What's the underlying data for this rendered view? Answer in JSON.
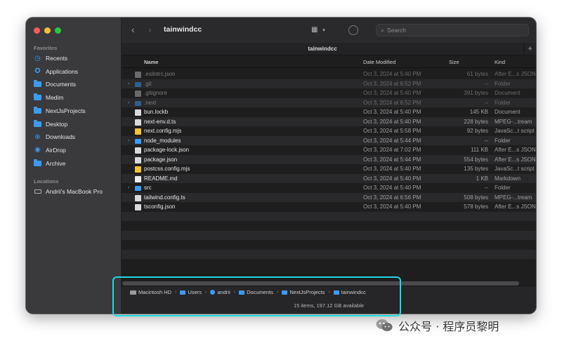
{
  "window": {
    "title": "tainwindcc",
    "tab_title": "tainwindcc",
    "search_placeholder": "Search",
    "view_icon": "grid-view-icon"
  },
  "sidebar": {
    "favorites_label": "Favorites",
    "favorites": [
      {
        "label": "Recents",
        "icon": "clock-icon"
      },
      {
        "label": "Applications",
        "icon": "applications-icon"
      },
      {
        "label": "Documents",
        "icon": "folder-icon"
      },
      {
        "label": "Medim",
        "icon": "folder-icon"
      },
      {
        "label": "NextJsProjects",
        "icon": "folder-icon"
      },
      {
        "label": "Desktop",
        "icon": "folder-icon"
      },
      {
        "label": "Downloads",
        "icon": "download-icon"
      },
      {
        "label": "AirDrop",
        "icon": "airdrop-icon"
      },
      {
        "label": "Archive",
        "icon": "folder-icon"
      }
    ],
    "locations_label": "Locations",
    "locations": [
      {
        "label": "Andrii's MacBook Pro",
        "icon": "laptop-icon"
      }
    ]
  },
  "columns": {
    "name": "Name",
    "date": "Date Modified",
    "size": "Size",
    "kind": "Kind"
  },
  "files": [
    {
      "name": ".eslintrc.json",
      "date": "Oct 3, 2024 at 5:40 PM",
      "size": "61 bytes",
      "kind": "After E...s JSON",
      "type": "doc",
      "hidden": true,
      "folder": false
    },
    {
      "name": ".git",
      "date": "Oct 3, 2024 at 6:52 PM",
      "size": "--",
      "kind": "Folder",
      "type": "folder",
      "hidden": true,
      "folder": true
    },
    {
      "name": ".gitignore",
      "date": "Oct 3, 2024 at 5:40 PM",
      "size": "391 bytes",
      "kind": "Document",
      "type": "doc",
      "hidden": true,
      "folder": false
    },
    {
      "name": ".next",
      "date": "Oct 3, 2024 at 6:52 PM",
      "size": "--",
      "kind": "Folder",
      "type": "folder",
      "hidden": true,
      "folder": true
    },
    {
      "name": "bun.lockb",
      "date": "Oct 3, 2024 at 5:40 PM",
      "size": "145 KB",
      "kind": "Document",
      "type": "doc",
      "hidden": false,
      "folder": false
    },
    {
      "name": "next-env.d.ts",
      "date": "Oct 3, 2024 at 5:40 PM",
      "size": "228 bytes",
      "kind": "MPEG-...tream",
      "type": "doc",
      "hidden": false,
      "folder": false
    },
    {
      "name": "next.config.mjs",
      "date": "Oct 3, 2024 at 5:58 PM",
      "size": "92 bytes",
      "kind": "JavaSc...t script",
      "type": "js",
      "hidden": false,
      "folder": false
    },
    {
      "name": "node_modules",
      "date": "Oct 3, 2024 at 5:44 PM",
      "size": "--",
      "kind": "Folder",
      "type": "folder",
      "hidden": false,
      "folder": true
    },
    {
      "name": "package-lock.json",
      "date": "Oct 3, 2024 at 7:02 PM",
      "size": "111 KB",
      "kind": "After E...s JSON",
      "type": "doc",
      "hidden": false,
      "folder": false
    },
    {
      "name": "package.json",
      "date": "Oct 3, 2024 at 5:44 PM",
      "size": "554 bytes",
      "kind": "After E...s JSON",
      "type": "doc",
      "hidden": false,
      "folder": false
    },
    {
      "name": "postcss.config.mjs",
      "date": "Oct 3, 2024 at 5:40 PM",
      "size": "135 bytes",
      "kind": "JavaSc...t script",
      "type": "js",
      "hidden": false,
      "folder": false
    },
    {
      "name": "README.md",
      "date": "Oct 3, 2024 at 5:40 PM",
      "size": "1 KB",
      "kind": "Markdown",
      "type": "md",
      "hidden": false,
      "folder": false
    },
    {
      "name": "src",
      "date": "Oct 3, 2024 at 5:40 PM",
      "size": "--",
      "kind": "Folder",
      "type": "folder",
      "hidden": false,
      "folder": true
    },
    {
      "name": "tailwind.config.ts",
      "date": "Oct 3, 2024 at 6:56 PM",
      "size": "508 bytes",
      "kind": "MPEG-...tream",
      "type": "doc",
      "hidden": false,
      "folder": false
    },
    {
      "name": "tsconfig.json",
      "date": "Oct 3, 2024 at 5:40 PM",
      "size": "578 bytes",
      "kind": "After E...s JSON",
      "type": "doc",
      "hidden": false,
      "folder": false
    }
  ],
  "pathbar": [
    {
      "label": "Macintosh HD",
      "icon": "disk-icon"
    },
    {
      "label": "Users",
      "icon": "folder-icon"
    },
    {
      "label": "andrii",
      "icon": "user-home-icon"
    },
    {
      "label": "Documents",
      "icon": "folder-icon"
    },
    {
      "label": "NextJsProjects",
      "icon": "folder-icon"
    },
    {
      "label": "tainwindcc",
      "icon": "folder-icon"
    }
  ],
  "status": "15 items, 197.12 GB available",
  "watermark": "公众号 · 程序员黎明",
  "colors": {
    "highlight": "#1ed9e0",
    "folder": "#3a9bf2"
  }
}
